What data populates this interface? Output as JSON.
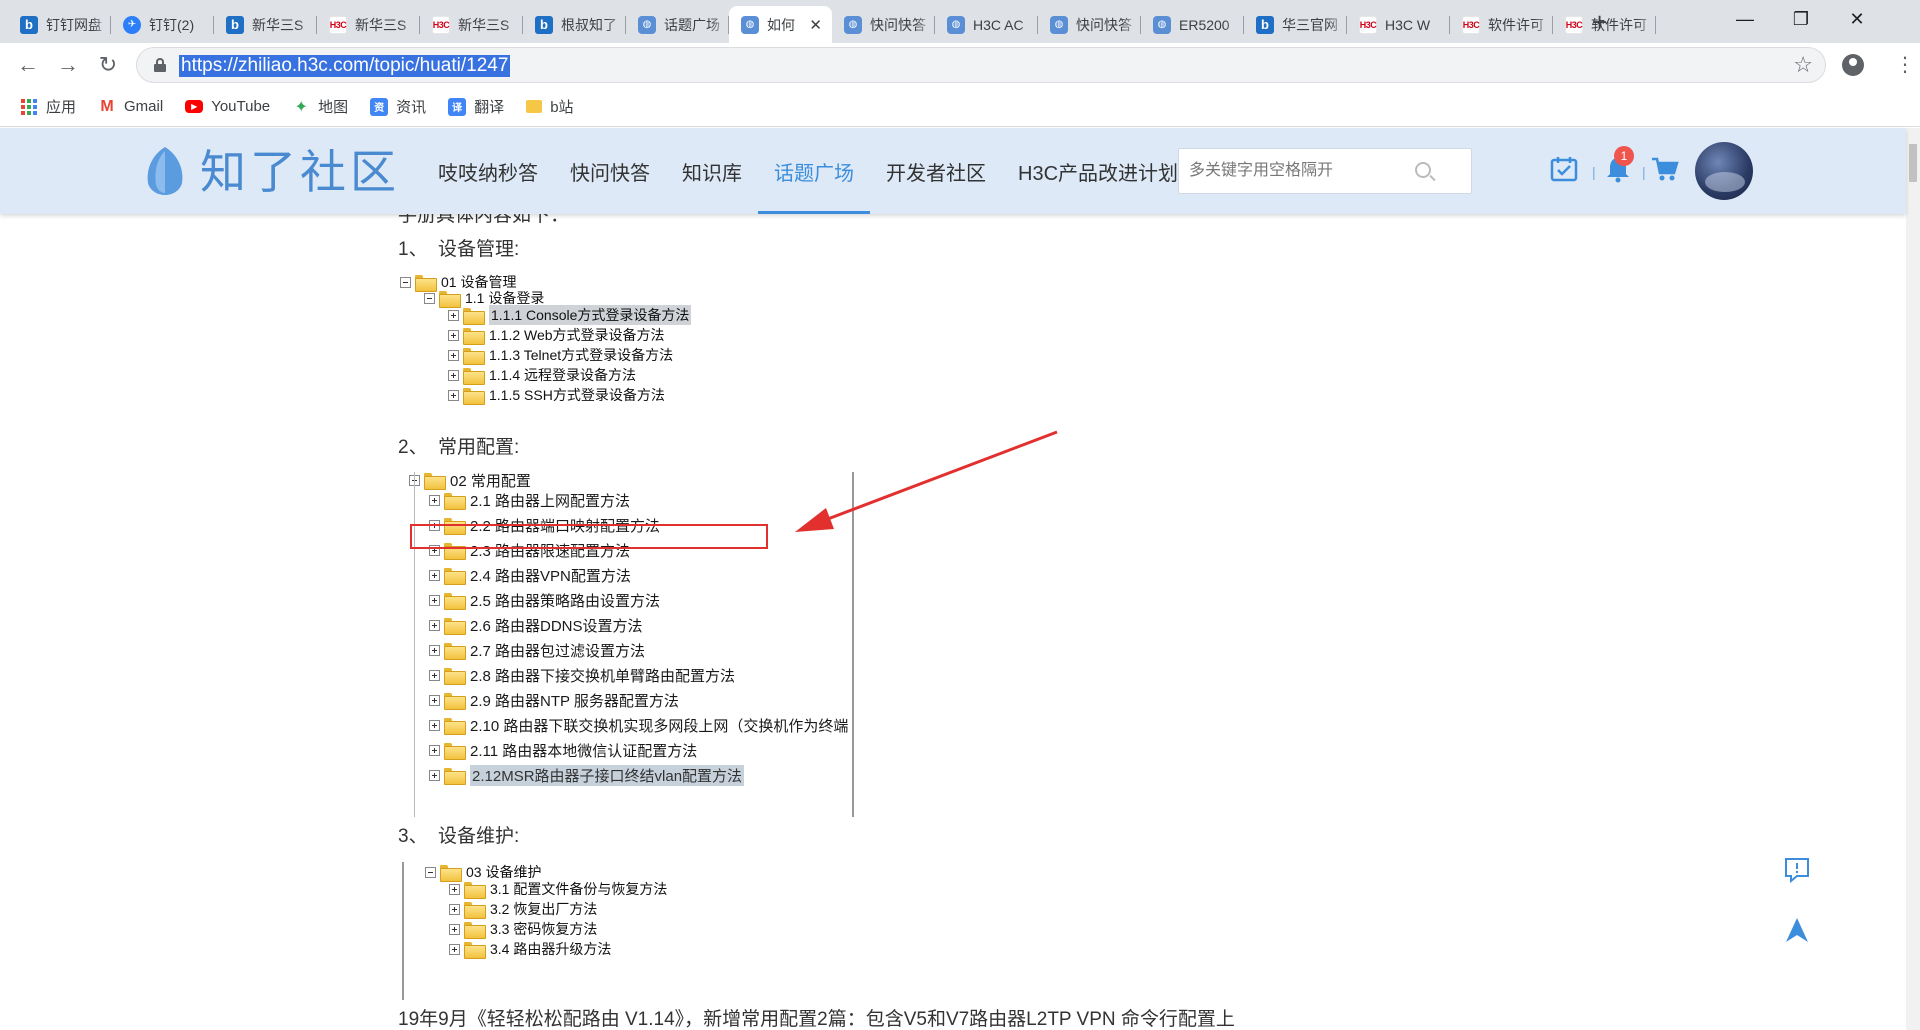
{
  "browser": {
    "tabs": [
      {
        "icon": "bing",
        "title": "钉钉网盘"
      },
      {
        "icon": "ding",
        "title": "钉钉(2)"
      },
      {
        "icon": "bing",
        "title": "新华三S"
      },
      {
        "icon": "h3c",
        "title": "新华三S"
      },
      {
        "icon": "h3c",
        "title": "新华三S"
      },
      {
        "icon": "bing",
        "title": "根叔知了"
      },
      {
        "icon": "zl",
        "title": "话题广场"
      },
      {
        "icon": "zl",
        "title": "如何"
      },
      {
        "icon": "zl",
        "title": "快问快答"
      },
      {
        "icon": "zl",
        "title": "H3C AC"
      },
      {
        "icon": "zl",
        "title": "快问快答"
      },
      {
        "icon": "zl",
        "title": "ER5200"
      },
      {
        "icon": "bing",
        "title": "华三官网"
      },
      {
        "icon": "h3c",
        "title": "H3C W"
      },
      {
        "icon": "h3c",
        "title": "软件许可"
      },
      {
        "icon": "h3c",
        "title": "软件许可"
      }
    ],
    "active_tab": 7,
    "url": "https://zhiliao.h3c.com/topic/huati/1247",
    "bookmarks": [
      {
        "icon": "apps",
        "label": "应用"
      },
      {
        "icon": "gmail",
        "label": "Gmail"
      },
      {
        "icon": "youtube",
        "label": "YouTube"
      },
      {
        "icon": "maps",
        "label": "地图"
      },
      {
        "icon": "news",
        "label": "资讯"
      },
      {
        "icon": "translate",
        "label": "翻译"
      },
      {
        "icon": "folder",
        "label": "b站"
      }
    ]
  },
  "site": {
    "logo": "知了社区",
    "nav": [
      "吱吱纳秒答",
      "快问快答",
      "知识库",
      "话题广场",
      "开发者社区",
      "H3C产品改进计划"
    ],
    "active_nav": 3,
    "search_placeholder": "多关键字用空格隔开",
    "notification_count": "1"
  },
  "article": {
    "cut_text": "手册具体内容如下：",
    "sections": [
      {
        "num": "1、",
        "title": "设备管理:"
      },
      {
        "num": "2、",
        "title": "常用配置:"
      },
      {
        "num": "3、",
        "title": "设备维护:"
      }
    ],
    "tree1": {
      "root": "01 设备管理",
      "child": "1.1 设备登录",
      "items": [
        "1.1.1 Console方式登录设备方法",
        "1.1.2 Web方式登录设备方法",
        "1.1.3 Telnet方式登录设备方法",
        "1.1.4 远程登录设备方法",
        "1.1.5 SSH方式登录设备方法"
      ]
    },
    "tree2": {
      "root": "02 常用配置",
      "items": [
        "2.1 路由器上网配置方法",
        "2.2 路由器端口映射配置方法",
        "2.3 路由器限速配置方法",
        "2.4 路由器VPN配置方法",
        "2.5 路由器策略路由设置方法",
        "2.6 路由器DDNS设置方法",
        "2.7 路由器包过滤设置方法",
        "2.8 路由器下接交换机单臂路由配置方法",
        "2.9 路由器NTP 服务器配置方法",
        "2.10 路由器下联交换机实现多网段上网（交换机作为终端",
        "2.11 路由器本地微信认证配置方法",
        "2.12MSR路由器子接口终结vlan配置方法"
      ]
    },
    "tree3": {
      "root": "03 设备维护",
      "items": [
        "3.1 配置文件备份与恢复方法",
        "3.2 恢复出厂方法",
        "3.3 密码恢复方法",
        "3.4 路由器升级方法"
      ]
    },
    "bottom_text": "19年9月《轻轻松松配路由 V1.14》，新增常用配置2篇：包含V5和V7路由器L2TP VPN 命令行配置上"
  }
}
